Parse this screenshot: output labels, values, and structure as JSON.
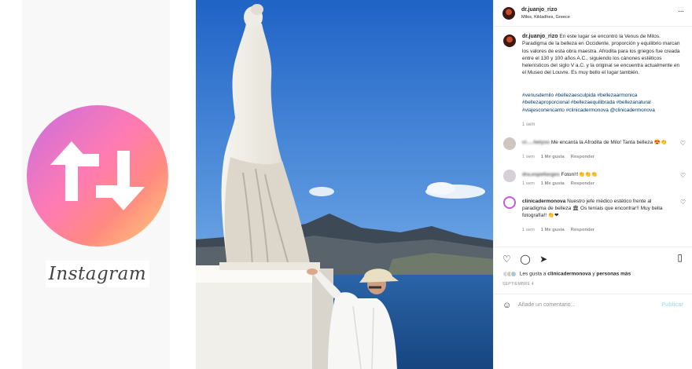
{
  "left": {
    "brand_word": "Instagram"
  },
  "post": {
    "username": "dr.juanjo_rizo",
    "location": "Milos, Kikladhes, Greece",
    "caption": "En este lugar se encontró la Venus de Milos. Paradigma de la belleza en Occidente, proporción y equilibrio marcan los valores de esta obra maestra. Afrodita para los griegos fue creada entre el 130 y 100 años A.C., siguiendo los cánones estéticos helenísticos del siglo V a.C. y la original se encuentra actualmente en el Museo del Louvre. Es muy bello el lugar también.",
    "hashtags": "#venusdemilo #bellezaesculpida #bellezaarmonica #bellezaproporcional #bellezaequilibrada #bellezanatural #viajesconencanto #clinicadermonova @clinicadermonova",
    "caption_time": "1 sem",
    "comments": [
      {
        "user": "cl.....helyos",
        "text": "Me encanta la Afrodita de Milo! Tanta belleza 😍👏",
        "time": "1 sem",
        "likes": "1 Me gusta",
        "reply": "Responder"
      },
      {
        "user": "dra.espellarges",
        "text": "Foton!!!👏👏👏",
        "time": "1 sem",
        "likes": "1 Me gusta",
        "reply": "Responder"
      },
      {
        "user": "clinicadermonova",
        "text": "Nuestro jefe médico estético frente al paradigma de belleza 🏛 Os teníais que encontrar!! Muy bella fotografía!! 👏❤",
        "time": "1 sem",
        "likes": "1 Me gusta",
        "reply": "Responder"
      }
    ],
    "liked_by_prefix": "Les gusta a",
    "liked_by_user": "clinicadermonova",
    "liked_by_and": "y",
    "liked_by_more": "personas más",
    "date": "SEPTIEMBRE 4",
    "add_comment_placeholder": "Añade un comentario...",
    "publish_label": "Publicar"
  }
}
